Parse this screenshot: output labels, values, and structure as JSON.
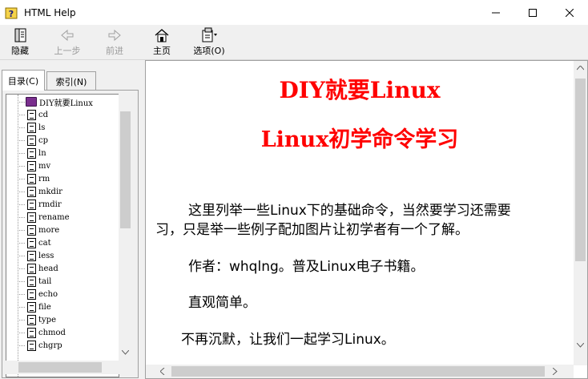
{
  "window": {
    "title": "HTML Help"
  },
  "toolbar": {
    "buttons": [
      {
        "label": "隐藏",
        "icon": "hide-pane-icon",
        "enabled": true
      },
      {
        "label": "上一步",
        "icon": "back-arrow-icon",
        "enabled": false
      },
      {
        "label": "前进",
        "icon": "forward-arrow-icon",
        "enabled": false
      },
      {
        "label": "主页",
        "icon": "home-icon",
        "enabled": true
      },
      {
        "label": "选项(O)",
        "icon": "options-icon",
        "enabled": true
      }
    ]
  },
  "tabs": [
    {
      "label": "目录(C)",
      "active": true
    },
    {
      "label": "索引(N)",
      "active": false
    }
  ],
  "tree": {
    "root": "DIY就要Linux",
    "items": [
      "cd",
      "ls",
      "cp",
      "ln",
      "mv",
      "rm",
      "mkdir",
      "rmdir",
      "rename",
      "more",
      "cat",
      "less",
      "head",
      "tail",
      "echo",
      "file",
      "type",
      "chmod",
      "chgrp"
    ]
  },
  "content": {
    "title": "DIY就要Linux",
    "subtitle": "Linux初学命令学习",
    "paragraphs": [
      "这里列举一些Linux下的基础命令，当然要学习还需要",
      "习，只是举一些例子配加图片让初学者有一个了解。",
      "作者：whqlng。普及Linux电子书籍。",
      "直观简单。",
      "不再沉默，让我们一起学习Linux。"
    ]
  },
  "colors": {
    "title_red": "#ff0000",
    "book_purple": "#7a2e8e"
  }
}
